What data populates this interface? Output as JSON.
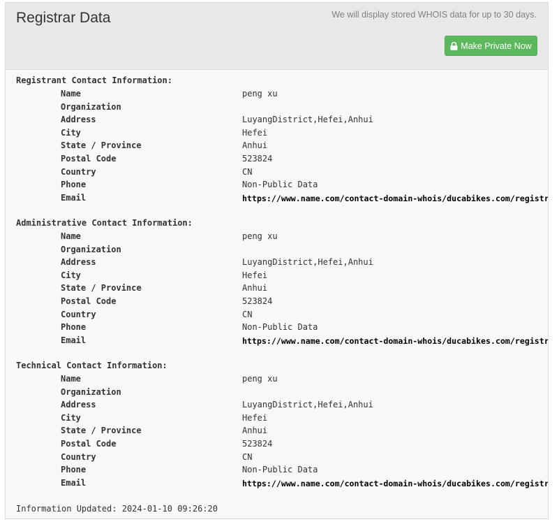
{
  "header": {
    "title": "Registrar Data",
    "note": "We will display stored WHOIS data for up to 30 days.",
    "private_button_label": "Make Private Now"
  },
  "sections": [
    {
      "heading": "Registrant Contact Information:",
      "fields": [
        {
          "label": "Name",
          "value": "peng xu"
        },
        {
          "label": "Organization",
          "value": ""
        },
        {
          "label": "Address",
          "value": "LuyangDistrict,Hefei,Anhui"
        },
        {
          "label": "City",
          "value": "Hefei"
        },
        {
          "label": "State / Province",
          "value": "Anhui"
        },
        {
          "label": "Postal Code",
          "value": "523824"
        },
        {
          "label": "Country",
          "value": "CN"
        },
        {
          "label": "Phone",
          "value": "Non-Public Data"
        },
        {
          "label": "Email",
          "value": "https://www.name.com/contact-domain-whois/ducabikes.com/registran"
        }
      ]
    },
    {
      "heading": "Administrative Contact Information:",
      "fields": [
        {
          "label": "Name",
          "value": "peng xu"
        },
        {
          "label": "Organization",
          "value": ""
        },
        {
          "label": "Address",
          "value": "LuyangDistrict,Hefei,Anhui"
        },
        {
          "label": "City",
          "value": "Hefei"
        },
        {
          "label": "State / Province",
          "value": "Anhui"
        },
        {
          "label": "Postal Code",
          "value": "523824"
        },
        {
          "label": "Country",
          "value": "CN"
        },
        {
          "label": "Phone",
          "value": "Non-Public Data"
        },
        {
          "label": "Email",
          "value": "https://www.name.com/contact-domain-whois/ducabikes.com/registran"
        }
      ]
    },
    {
      "heading": "Technical Contact Information:",
      "fields": [
        {
          "label": "Name",
          "value": "peng xu"
        },
        {
          "label": "Organization",
          "value": ""
        },
        {
          "label": "Address",
          "value": "LuyangDistrict,Hefei,Anhui"
        },
        {
          "label": "City",
          "value": "Hefei"
        },
        {
          "label": "State / Province",
          "value": "Anhui"
        },
        {
          "label": "Postal Code",
          "value": "523824"
        },
        {
          "label": "Country",
          "value": "CN"
        },
        {
          "label": "Phone",
          "value": "Non-Public Data"
        },
        {
          "label": "Email",
          "value": "https://www.name.com/contact-domain-whois/ducabikes.com/registran"
        }
      ]
    }
  ],
  "updated": "Information Updated: 2024-01-10 09:26:20"
}
